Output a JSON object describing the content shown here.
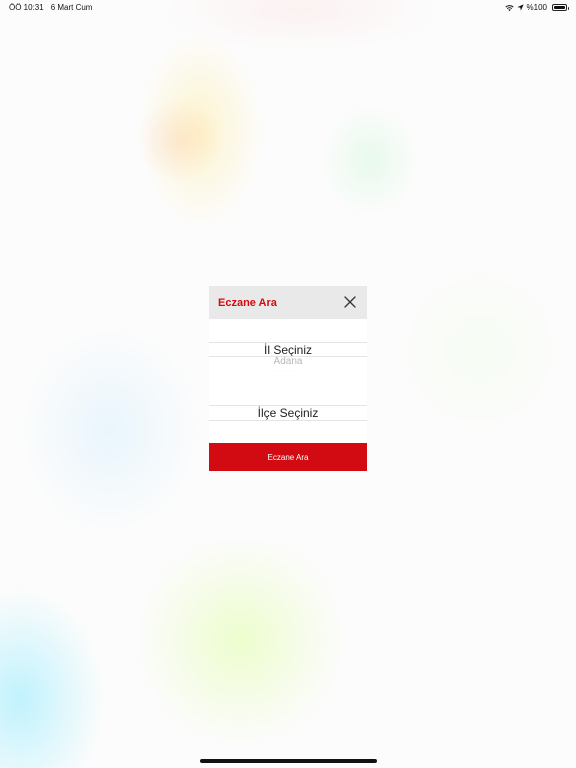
{
  "status_bar": {
    "time": "ÖÖ 10:31",
    "date": "6 Mart Cum",
    "battery": "%100",
    "icons": [
      "wifi-icon",
      "location-arrow-icon",
      "battery-icon"
    ]
  },
  "modal": {
    "title": "Eczane Ara",
    "close_icon": "close-icon",
    "city_picker": {
      "selected": "İl Seçiniz",
      "next_option": "Adana",
      "faded_option": "· · · · · ·"
    },
    "district_picker": {
      "selected": "İlçe Seçiniz"
    },
    "search_button_label": "Eczane Ara"
  },
  "colors": {
    "accent": "#d20b12",
    "header_bg": "#e9e9e9"
  }
}
